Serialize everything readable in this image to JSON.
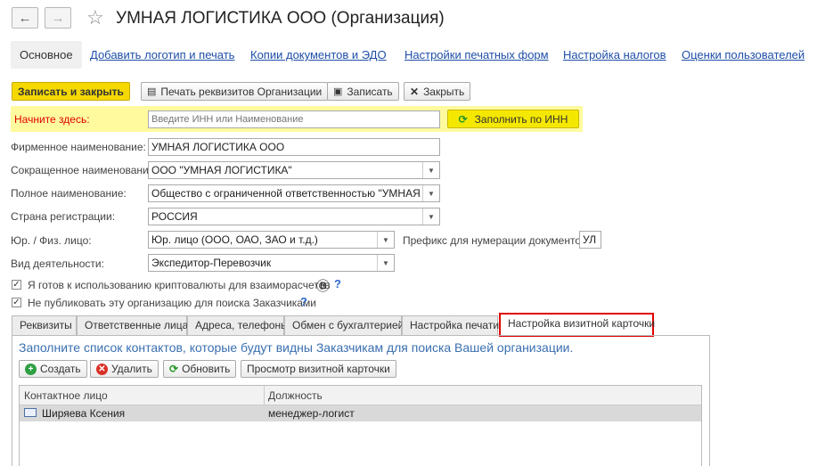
{
  "window": {
    "title": "УМНАЯ ЛОГИСТИКА ООО (Организация)"
  },
  "top_tabs": [
    "Основное",
    "Добавить логотип и печать",
    "Копии документов и ЭДО",
    "Настройки печатных форм",
    "Настройка налогов",
    "Оценки пользователей"
  ],
  "toolbar": {
    "save_close": "Записать и закрыть",
    "print_details": "Печать реквизитов Организации",
    "save": "Записать",
    "close": "Закрыть"
  },
  "start": {
    "label": "Начните здесь:",
    "placeholder": "Введите ИНН или Наименование",
    "fill_button": "Заполнить по ИНН"
  },
  "fields": {
    "firm_name_label": "Фирменное наименование:",
    "firm_name_value": "УМНАЯ ЛОГИСТИКА ООО",
    "short_name_label": "Сокращенное наименование:",
    "short_name_value": "ООО \"УМНАЯ ЛОГИСТИКА\"",
    "full_name_label": "Полное наименование:",
    "full_name_value": "Общество с ограниченной ответственностью \"УМНАЯ ЛОГИСТИКА\"",
    "country_label": "Страна регистрации:",
    "country_value": "РОССИЯ",
    "entity_label": "Юр. / Физ. лицо:",
    "entity_value": "Юр. лицо (ООО, ОАО, ЗАО и т.д.)",
    "prefix_label": "Префикс для нумерации документов :",
    "prefix_value": "УЛ",
    "activity_label": "Вид деятельности:",
    "activity_value": "Экспедитор-Перевозчик"
  },
  "checkboxes": {
    "crypto": "Я готов к использованию криптовалюты для взаиморасчетов",
    "crypto_icon": "Ⓑ",
    "no_publish": "Не публиковать эту организацию для поиска Заказчиками",
    "help": "?"
  },
  "bottom_tabs": [
    "Реквизиты",
    "Ответственные лица",
    "Адреса, телефоны",
    "Обмен с бухгалтерией",
    "Настройка печати",
    "Настройка визитной карточки"
  ],
  "card": {
    "info": "Заполните список контактов, которые будут видны Заказчикам для поиска Вашей организации.",
    "create": "Создать",
    "delete": "Удалить",
    "refresh": "Обновить",
    "preview": "Просмотр визитной карточки",
    "columns": [
      "Контактное лицо",
      "Должность"
    ],
    "rows": [
      {
        "name": "Ширяева Ксения",
        "position": "менеджер-логист"
      }
    ]
  },
  "colors": {
    "accent": "#f5d800",
    "link": "#1f4fa8",
    "highlight": "#fffa9e",
    "tab_border": "#e00000"
  }
}
